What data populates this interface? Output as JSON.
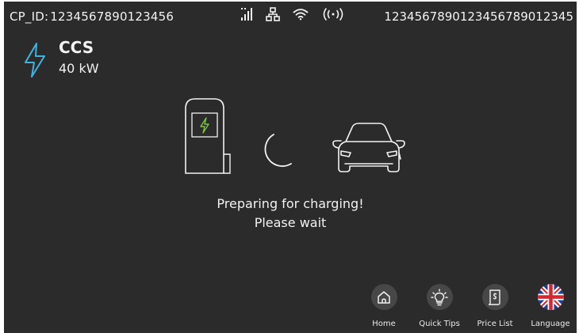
{
  "status_bar": {
    "cp_id_label": "CP_ID:",
    "cp_id_value": "1234567890123456",
    "serial": "1234567890123456789012345",
    "icons": [
      "signal-strength-icon",
      "ethernet-network-icon",
      "wifi-icon",
      "wireless-broadcast-icon"
    ]
  },
  "connector": {
    "type": "CCS",
    "power": "40 kW",
    "icon": "lightning-bolt-icon",
    "accent": "#3fb3e0"
  },
  "illustration": {
    "charger_icon": "charging-station-icon",
    "spinner_icon": "loading-spinner-icon",
    "car_icon": "car-front-icon",
    "bolt_color": "#7cc243"
  },
  "message": {
    "line1": "Preparing for charging!",
    "line2": "Please wait"
  },
  "nav": {
    "home": "Home",
    "quick_tips": "Quick Tips",
    "price_list": "Price List",
    "language": "Language",
    "language_flag": "united-kingdom-flag-icon"
  },
  "colors": {
    "background": "#2b2b2b",
    "text": "#f2f2f2",
    "nav_button": "#474747"
  }
}
